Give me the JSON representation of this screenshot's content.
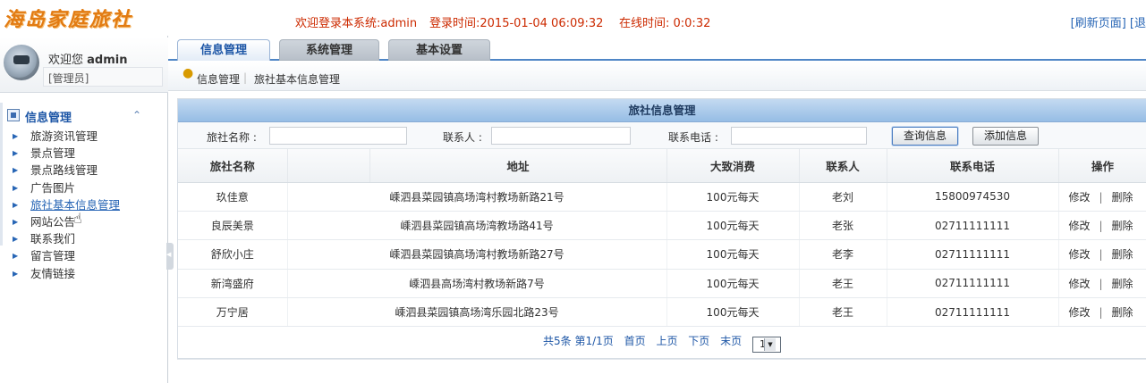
{
  "header": {
    "logo": "海岛家庭旅社",
    "welcome": "欢迎登录本系统:admin",
    "login_time": "登录时间:2015-01-04 06:09:32",
    "online_time": "在线时间: 0:0:32",
    "refresh_link": "[刷新页面] [退"
  },
  "sidebar": {
    "welcome_text": "欢迎您",
    "username": "admin",
    "role": "[管理员]",
    "menu_title": "信息管理",
    "toggle_icon": "chevron-double-up-icon",
    "items": [
      {
        "label": "旅游资讯管理"
      },
      {
        "label": "景点管理"
      },
      {
        "label": "景点路线管理"
      },
      {
        "label": "广告图片"
      },
      {
        "label": "旅社基本信息管理"
      },
      {
        "label": "网站公告"
      },
      {
        "label": "联系我们"
      },
      {
        "label": "留言管理"
      },
      {
        "label": "友情链接"
      }
    ],
    "active_index": 4
  },
  "tabs": [
    {
      "label": "信息管理"
    },
    {
      "label": "系统管理"
    },
    {
      "label": "基本设置"
    }
  ],
  "breadcrumb": {
    "level1": "信息管理",
    "level2": "旅社基本信息管理"
  },
  "panel": {
    "title": "旅社信息管理",
    "search": {
      "name_label": "旅社名称 :",
      "name_value": "",
      "contact_label": "联系人 :",
      "contact_value": "",
      "phone_label": "联系电话 :",
      "phone_value": "",
      "query_button": "查询信息",
      "add_button": "添加信息"
    },
    "table": {
      "headers": [
        "旅社名称",
        "",
        "地址",
        "大致消费",
        "联系人",
        "联系电话",
        "操作"
      ],
      "rows": [
        {
          "name": "玖佳意",
          "address": "嵊泗县菜园镇高场湾村教场新路21号",
          "cost": "100元每天",
          "contact": "老刘",
          "phone": "15800974530"
        },
        {
          "name": "良辰美景",
          "address": "嵊泗县菜园镇高场湾教场路41号",
          "cost": "100元每天",
          "contact": "老张",
          "phone": "02711111111"
        },
        {
          "name": "舒欣小庄",
          "address": "嵊泗县菜园镇高场湾村教场新路27号",
          "cost": "100元每天",
          "contact": "老李",
          "phone": "02711111111"
        },
        {
          "name": "新湾盛府",
          "address": "嵊泗县高场湾村教场新路7号",
          "cost": "100元每天",
          "contact": "老王",
          "phone": "02711111111"
        },
        {
          "name": "万宁居",
          "address": "嵊泗县菜园镇高场湾乐园北路23号",
          "cost": "100元每天",
          "contact": "老王",
          "phone": "02711111111"
        }
      ],
      "edit_label": "修改",
      "op_separator": "|",
      "delete_label": "删除"
    },
    "pager": {
      "summary": "共5条 第1/1页",
      "first": "首页",
      "prev": "上页",
      "next": "下页",
      "last": "末页",
      "page_value": "1"
    }
  },
  "colors": {
    "logo": "#e27b12",
    "header_text": "#cc2a00",
    "link": "#2765b5",
    "panel_title_bg": "#96bde5",
    "tab_border": "#4f86c6"
  }
}
